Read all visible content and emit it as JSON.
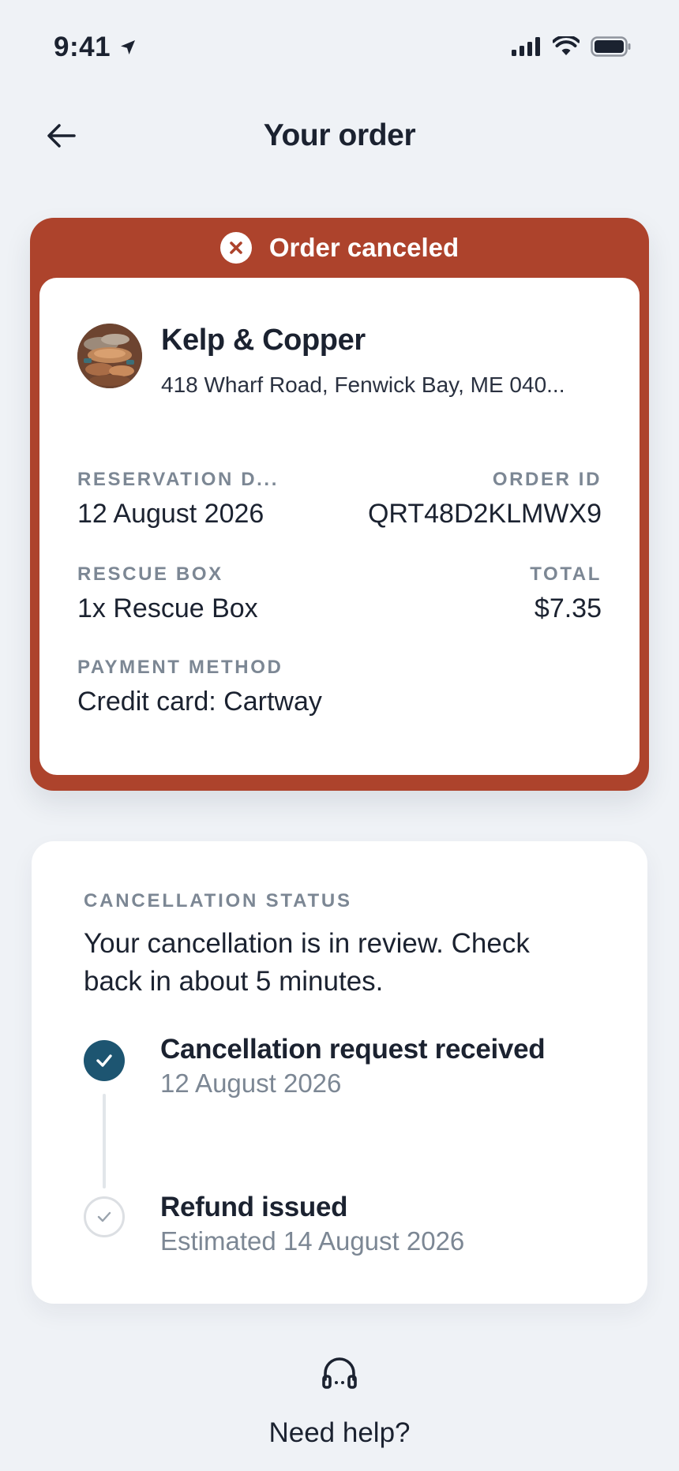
{
  "status_bar": {
    "time": "9:41"
  },
  "header": {
    "title": "Your order",
    "back_icon": "arrow-left-icon"
  },
  "order": {
    "status_banner": "Order canceled",
    "status_color": "#ad432c",
    "store": {
      "name": "Kelp & Copper",
      "address": "418 Wharf Road, Fenwick Bay, ME 040..."
    },
    "fields": {
      "reservation_date_label": "RESERVATION D...",
      "reservation_date": "12 August 2026",
      "order_id_label": "ORDER ID",
      "order_id": "QRT48D2KLMWX9",
      "item_label": "RESCUE BOX",
      "item": "1x Rescue Box",
      "total_label": "TOTAL",
      "total": "$7.35",
      "payment_label": "PAYMENT METHOD",
      "payment": "Credit card: Cartway"
    }
  },
  "cancellation": {
    "label": "CANCELLATION STATUS",
    "message": "Your cancellation is in review. Check back in about 5 minutes.",
    "steps": [
      {
        "title": "Cancellation request received",
        "subtitle": "12 August 2026",
        "state": "done"
      },
      {
        "title": "Refund issued",
        "subtitle": "Estimated 14 August 2026",
        "state": "pending"
      }
    ],
    "done_color": "#1d5571"
  },
  "help": {
    "label": "Need help?",
    "icon": "headset-icon"
  }
}
